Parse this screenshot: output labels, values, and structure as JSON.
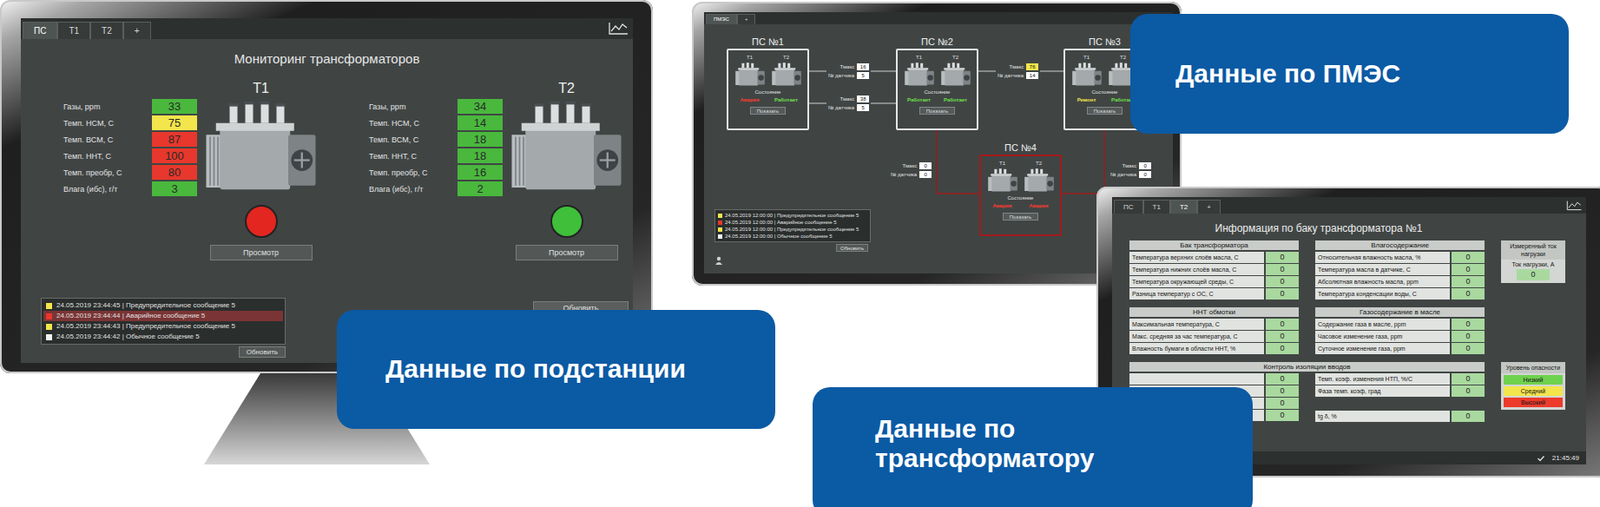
{
  "callouts": [
    "Данные по ПМЭС",
    "Данные по подстанции",
    "Данные по трансформатору"
  ],
  "substation_screen": {
    "tabs": [
      {
        "label": "ПС",
        "selected": true
      },
      {
        "label": "Т1",
        "selected": false
      },
      {
        "label": "Т2",
        "selected": false
      },
      {
        "label": "+",
        "selected": false
      }
    ],
    "title": "Мониторинг трансформаторов",
    "transformers": [
      {
        "name": "Т1",
        "status_color": "#e3261f",
        "button": "Просмотр",
        "params": [
          {
            "label": "Газы, ppm",
            "value": "33",
            "color": "#49b83d"
          },
          {
            "label": "Темп. НСМ, С",
            "value": "75",
            "color": "#f3e54c"
          },
          {
            "label": "Темп. ВСМ, С",
            "value": "87",
            "color": "#e8372c"
          },
          {
            "label": "Темп. ННТ, С",
            "value": "100",
            "color": "#e8372c"
          },
          {
            "label": "Темп. преобр, С",
            "value": "80",
            "color": "#e8372c"
          },
          {
            "label": "Влага (ибс), г/т",
            "value": "3",
            "color": "#49b83d"
          }
        ]
      },
      {
        "name": "Т2",
        "status_color": "#3fbf3a",
        "button": "Просмотр",
        "params": [
          {
            "label": "Газы, ppm",
            "value": "34",
            "color": "#49b83d"
          },
          {
            "label": "Темп. НСМ, С",
            "value": "14",
            "color": "#49b83d"
          },
          {
            "label": "Темп. ВСМ, С",
            "value": "18",
            "color": "#49b83d"
          },
          {
            "label": "Темп. ННТ, С",
            "value": "18",
            "color": "#49b83d"
          },
          {
            "label": "Темп. преобр, С",
            "value": "16",
            "color": "#49b83d"
          },
          {
            "label": "Влага (ибс), г/т",
            "value": "2",
            "color": "#49b83d"
          }
        ]
      }
    ],
    "log": [
      {
        "text": "24.05.2019 23:44:45 | Предупредительное сообщение 5",
        "color": "#f3e54c",
        "selected": false
      },
      {
        "text": "24.05.2019 23:44:44 | Аварийное сообщение 5",
        "color": "#e8372c",
        "selected": true
      },
      {
        "text": "24.05.2019 23:44:43 | Предупредительное сообщение 5",
        "color": "#f3e54c",
        "selected": false
      },
      {
        "text": "24.05.2019 23:44:42 | Обычное сообщение 5",
        "color": "#f2f2f2",
        "selected": false
      }
    ],
    "log_button": "Обновить",
    "refresh_button": "Обновить"
  },
  "pmes_screen": {
    "tabs": [
      {
        "label": "ПМЭС",
        "selected": true
      },
      {
        "label": "+",
        "selected": false
      }
    ],
    "substations": [
      {
        "name": "ПС №1",
        "alarm": false,
        "state_label": "Состояние",
        "button": "Показать",
        "transformers": [
          {
            "name": "Т1",
            "status": "Авария",
            "color": "#ff3b2f"
          },
          {
            "name": "Т2",
            "status": "Работает",
            "color": "#6ee04a"
          }
        ]
      },
      {
        "name": "ПС №2",
        "alarm": false,
        "state_label": "Состояние",
        "button": "Показать",
        "transformers": [
          {
            "name": "Т1",
            "status": "Работает",
            "color": "#6ee04a"
          },
          {
            "name": "Т2",
            "status": "Работает",
            "color": "#6ee04a"
          }
        ]
      },
      {
        "name": "ПС №3",
        "alarm": false,
        "state_label": "Состояние",
        "button": "Показать",
        "transformers": [
          {
            "name": "Т1",
            "status": "Ремонт",
            "color": "#f3e54c"
          },
          {
            "name": "Т2",
            "status": "Работает",
            "color": "#6ee04a"
          }
        ]
      },
      {
        "name": "ПС №4",
        "alarm": true,
        "state_label": "Состояние",
        "button": "Показать",
        "transformers": [
          {
            "name": "Т1",
            "status": "Авария",
            "color": "#ff3b2f"
          },
          {
            "name": "Т2",
            "status": "Авария",
            "color": "#ff3b2f"
          }
        ]
      }
    ],
    "links": [
      {
        "tmax_label": "Тмакс",
        "tmax": "16",
        "sensor_label": "№ датчика",
        "sensor": "5",
        "color": "#ffffff"
      },
      {
        "tmax_label": "Тмакс",
        "tmax": "38",
        "sensor_label": "№ датчика",
        "sensor": "5",
        "color": "#ffffff"
      },
      {
        "tmax_label": "Тмакс",
        "tmax": "76",
        "sensor_label": "№ датчика",
        "sensor": "14",
        "color": "#f3e54c"
      },
      {
        "tmax_label": "Тмакс",
        "tmax": "0",
        "sensor_label": "№ датчика",
        "sensor": "0",
        "color": "#ffffff"
      },
      {
        "tmax_label": "Тмакс",
        "tmax": "0",
        "sensor_label": "№ датчика",
        "sensor": "0",
        "color": "#ffffff"
      }
    ],
    "log": [
      {
        "text": "24.05.2019 12:00:00 | Предупредительное сообщение 5",
        "color": "#f3e54c"
      },
      {
        "text": "24.05.2019 12:00:00 | Аварийное сообщение 5",
        "color": "#e8372c"
      },
      {
        "text": "24.05.2019 12:00:00 | Предупредительное сообщение 5",
        "color": "#f3e54c"
      },
      {
        "text": "24.05.2019 12:00:00 | Обычное сообщение 5",
        "color": "#f2f2f2"
      }
    ],
    "log_button": "Обновить"
  },
  "transformer_screen": {
    "tabs": [
      {
        "label": "ПС",
        "selected": false
      },
      {
        "label": "Т1",
        "selected": false
      },
      {
        "label": "Т2",
        "selected": true
      },
      {
        "label": "+",
        "selected": false
      }
    ],
    "title": "Информация по баку трансформатора №1",
    "sections": [
      {
        "title": "Бак трансформатора",
        "rows": [
          {
            "label": "Температура верхних слоёв масла, С",
            "value": "0"
          },
          {
            "label": "Температура нижних слоёв масла, С",
            "value": "0"
          },
          {
            "label": "Температура окружающей среды, С",
            "value": "0"
          },
          {
            "label": "Разница температур с ОС, С",
            "value": "0"
          }
        ]
      },
      {
        "title": "Влагосодержание",
        "rows": [
          {
            "label": "Относительная влажность масла, %",
            "value": "0"
          },
          {
            "label": "Температура масла в датчике, С",
            "value": "0"
          },
          {
            "label": "Абсолютная влажность масла, ppm",
            "value": "0"
          },
          {
            "label": "Температура конденсации воды, С",
            "value": "0"
          }
        ]
      },
      {
        "title": "ННТ обмотки",
        "rows": [
          {
            "label": "Максимальная температура, С",
            "value": "0"
          },
          {
            "label": "Макс. средняя за час температура, С",
            "value": "0"
          },
          {
            "label": "Влажность бумаги в области ННТ, %",
            "value": "0"
          }
        ]
      },
      {
        "title": "Газосодержание в масле",
        "rows": [
          {
            "label": "Содержание газа в масле, ppm",
            "value": "0"
          },
          {
            "label": "Часовое изменение газа, ppm",
            "value": "0"
          },
          {
            "label": "Суточное изменение газа, ppm",
            "value": "0"
          }
        ]
      }
    ],
    "load": {
      "title": "Измеренный ток нагрузки",
      "label": "Ток нагрузки, А",
      "value": "0"
    },
    "insulation": {
      "title": "Контроль изоляции вводов",
      "left_values": [
        "0",
        "0",
        "0",
        "0"
      ],
      "rows": [
        {
          "label": "Темп. коэф. изменения НТП, %/С",
          "value": "0"
        },
        {
          "label": "Фаза темп. коэф, град",
          "value": "0"
        },
        {
          "label": "tg δ, %",
          "value": "0"
        }
      ]
    },
    "danger": {
      "title": "Уровень опасности",
      "levels": [
        {
          "label": "Низкий",
          "color": "#6fd24f"
        },
        {
          "label": "Средний",
          "color": "#f3e54c"
        },
        {
          "label": "Высокий",
          "color": "#ec3a2c"
        }
      ]
    },
    "time": "21:45:49"
  }
}
